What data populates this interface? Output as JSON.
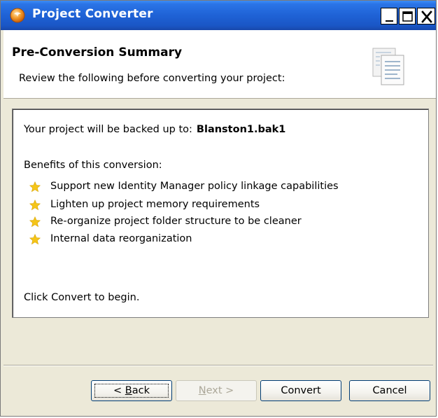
{
  "window": {
    "title": "Project Converter",
    "controls": [
      "minimize-icon",
      "maximize-icon",
      "close-icon"
    ]
  },
  "header": {
    "title": "Pre-Conversion Summary",
    "subtitle": "Review the following before converting your project:",
    "icon": "document-icon"
  },
  "content": {
    "backup_prefix": "Your project will be backed up to:",
    "backup_file": "Blanston1.bak1",
    "benefits_heading": "Benefits of this conversion:",
    "benefits": [
      "Support new Identity Manager policy linkage capabilities",
      "Lighten up project memory requirements",
      "Re-organize project folder structure to be cleaner",
      "Internal data reorganization"
    ],
    "benefit_icon": "star-icon",
    "convert_prompt": "Click Convert to begin."
  },
  "buttons": {
    "back_prefix": "< ",
    "back_mnemonic": "B",
    "back_rest": "ack",
    "next_mnemonic": "N",
    "next_rest": "ext >",
    "convert": "Convert",
    "cancel": "Cancel"
  },
  "colors": {
    "titlebar": "#1f62d6",
    "face": "#ece9d8",
    "star": "#f5c518",
    "disabled_text": "#aca899"
  }
}
